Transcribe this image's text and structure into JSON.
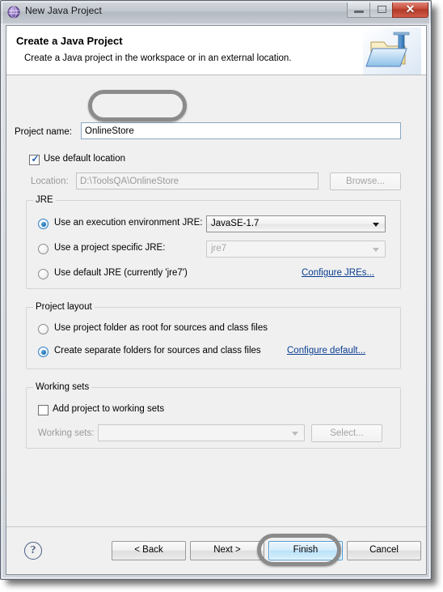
{
  "window": {
    "title": "New Java Project",
    "icon": "eclipse-wizard-icon",
    "controls": {
      "minimize": "—",
      "maximize": "□",
      "close": "✕"
    }
  },
  "banner": {
    "title": "Create a Java Project",
    "description": "Create a Java project in the workspace or in an external location.",
    "art": "java-project-folder-icon"
  },
  "form": {
    "project_name": {
      "label": "Project name:",
      "value": "OnlineStore",
      "placeholder": ""
    },
    "use_default_location": {
      "label": "Use default location",
      "checked": true
    },
    "location": {
      "label": "Location:",
      "value": "D:\\ToolsQA\\OnlineStore",
      "enabled": false
    },
    "browse_button": {
      "label": "Browse...",
      "enabled": false
    }
  },
  "jre_group": {
    "title": "JRE",
    "options": [
      {
        "label": "Use an execution environment JRE:",
        "selected": true,
        "combo_value": "JavaSE-1.7",
        "combo_enabled": true
      },
      {
        "label": "Use a project specific JRE:",
        "selected": false,
        "combo_value": "jre7",
        "combo_enabled": false
      },
      {
        "label": "Use default JRE (currently 'jre7')",
        "selected": false
      }
    ],
    "configure_link": "Configure JREs..."
  },
  "layout_group": {
    "title": "Project layout",
    "options": [
      {
        "label": "Use project folder as root for sources and class files",
        "selected": false
      },
      {
        "label": "Create separate folders for sources and class files",
        "selected": true
      }
    ],
    "configure_link": "Configure default..."
  },
  "working_sets_group": {
    "title": "Working sets",
    "add_checkbox": {
      "label": "Add project to working sets",
      "checked": false
    },
    "working_sets_label": "Working sets:",
    "working_sets_value": "",
    "select_button": "Select..."
  },
  "buttons": {
    "help": "?",
    "back": "< Back",
    "next": "Next >",
    "finish": "Finish",
    "cancel": "Cancel"
  },
  "annotations": [
    {
      "name": "highlight-project-name",
      "target": "project-name-field"
    },
    {
      "name": "highlight-finish",
      "target": "finish-button"
    }
  ],
  "colors": {
    "accent_blue": "#4b9ad4",
    "link_blue": "#0a3d91",
    "close_red": "#c9503e",
    "dialog_bg": "#f0f0f0",
    "annotation_gray": "#8b8b8b"
  }
}
